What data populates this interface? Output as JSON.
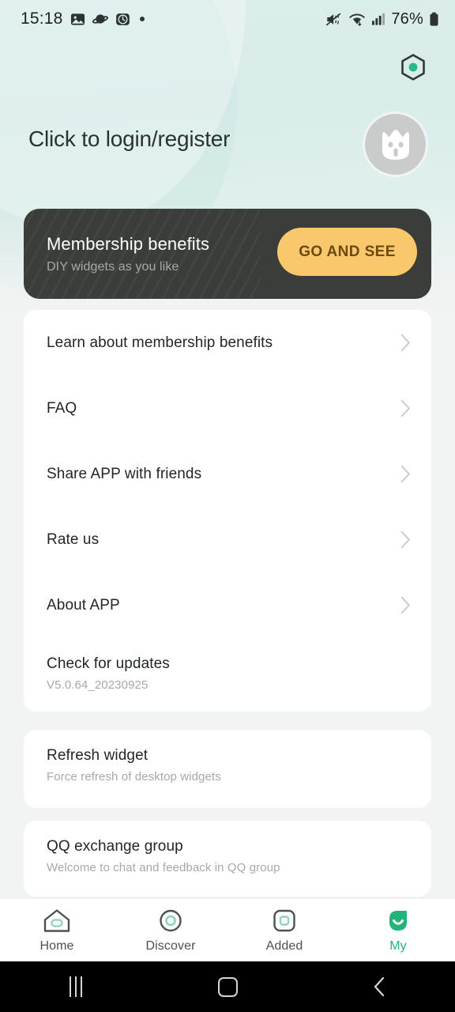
{
  "status_bar": {
    "time": "15:18",
    "left_icons": [
      "image-icon",
      "saturn-icon",
      "alarm-icon",
      "dot-icon"
    ],
    "right_icons": [
      "mute-icon",
      "wifi-icon",
      "signal-icon"
    ],
    "battery_percent": "76%"
  },
  "header": {
    "settings_icon": "hexagon-settings-icon",
    "greeting": "Click to login/register",
    "avatar_icon": "cat-avatar-icon",
    "accent_color": "#23b278",
    "background_color": "#dbeeea"
  },
  "membership_card": {
    "title": "Membership benefits",
    "subtitle": "DIY widgets as you like",
    "button_label": "GO AND SEE",
    "button_color": "#f9c86c",
    "card_color": "#3a3d39"
  },
  "main_list": [
    {
      "title": "Learn about membership benefits",
      "subtitle": "",
      "chevron": true
    },
    {
      "title": "FAQ",
      "subtitle": "",
      "chevron": true
    },
    {
      "title": "Share APP with friends",
      "subtitle": "",
      "chevron": true
    },
    {
      "title": "Rate us",
      "subtitle": "",
      "chevron": true
    },
    {
      "title": "About APP",
      "subtitle": "",
      "chevron": true
    },
    {
      "title": "Check for updates",
      "subtitle": "V5.0.64_20230925",
      "chevron": false
    }
  ],
  "refresh_card": {
    "title": "Refresh widget",
    "subtitle": "Force refresh of desktop widgets"
  },
  "qq_card": {
    "title": "QQ exchange group",
    "subtitle": "Welcome to chat and feedback in QQ group"
  },
  "tabbar": {
    "active": "My",
    "items": [
      {
        "label": "Home",
        "icon": "home-icon"
      },
      {
        "label": "Discover",
        "icon": "compass-circle-icon"
      },
      {
        "label": "Added",
        "icon": "rounded-square-icon"
      },
      {
        "label": "My",
        "icon": "leaf-smile-icon"
      }
    ]
  },
  "android_nav": {
    "recents": "recents-icon",
    "home": "home-square-icon",
    "back": "back-chevron-icon"
  }
}
